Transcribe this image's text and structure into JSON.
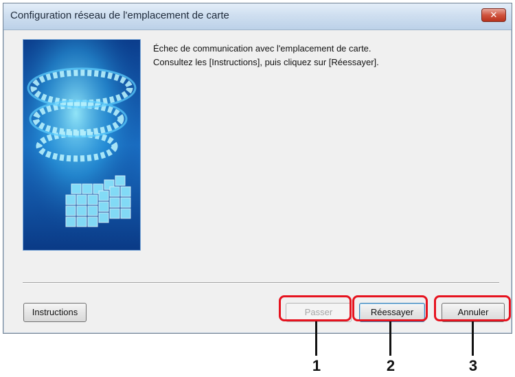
{
  "window": {
    "title": "Configuration réseau de l'emplacement de carte",
    "close_glyph": "✕"
  },
  "message": {
    "line1": "Échec de communication avec l'emplacement de carte.",
    "line2": "Consultez les [Instructions], puis cliquez sur [Réessayer]."
  },
  "buttons": {
    "instructions": "Instructions",
    "skip": "Passer",
    "retry": "Réessayer",
    "cancel": "Annuler"
  },
  "callouts": [
    "1",
    "2",
    "3"
  ],
  "colors": {
    "highlight": "#e6121e",
    "art_background": "#1a4fa8",
    "art_glow": "#7fe4ff"
  }
}
